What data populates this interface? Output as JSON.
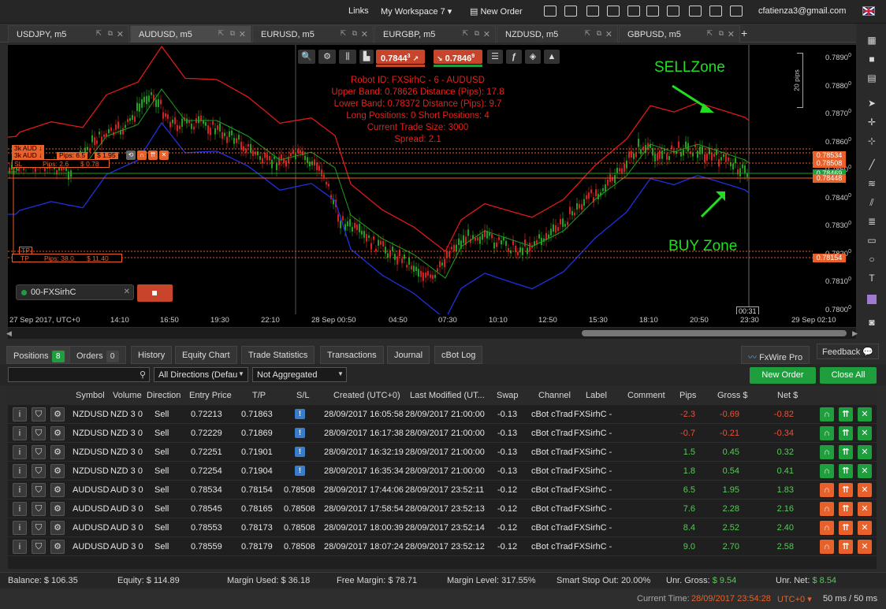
{
  "topbar": {
    "links_label": "Links",
    "workspace_label": "My Workspace 7",
    "new_order_label": "New Order",
    "user_email": "cfatienza3@gmail.com"
  },
  "tabs": [
    {
      "label": "USDJPY, m5"
    },
    {
      "label": "AUDUSD, m5"
    },
    {
      "label": "EURUSD, m5"
    },
    {
      "label": "EURGBP, m5"
    },
    {
      "label": "NZDUSD, m5"
    },
    {
      "label": "GBPUSD, m5"
    }
  ],
  "tab_add_label": "+",
  "chart": {
    "sell_price": "0.7844",
    "sell_price_sup": "3",
    "buy_price": "0.7846",
    "buy_price_sup": "9",
    "info_lines": [
      "Robot ID: FXSirhC - 6 - AUDUSD",
      "Upper Band: 0.78626 Distance (Pips): 17.8",
      "Lower Band: 0.78372 Distance (Pips): 9.7",
      "Long Positions: 0 Short Positions: 4",
      "Current Trade Size: 3000",
      "Spread: 2.1"
    ],
    "sell_zone_label": "SELLZone",
    "buy_zone_label": "BUY Zone",
    "pos_labels": {
      "a1": "3k AUD ↓",
      "a2": "3k AUD ↓",
      "pips1": "Pips: 6.5",
      "usd1": "$ 1.95",
      "sl": "SL",
      "sl_pips": "Pips: 2.6",
      "sl_usd": "$ 0.78",
      "tp1": "TP",
      "tp2": "TP",
      "tp_pips": "Pips: 38.0",
      "tp_usd": "$ 11.40"
    },
    "cbot_label": "00-FXSirhC",
    "pips_scale_label": "20 pips",
    "cursor_time": "00:31",
    "price_labels": [
      "0.7890",
      "0.7880",
      "0.7870",
      "0.7860",
      "0.7850",
      "0.7840",
      "0.7830",
      "0.7820",
      "0.7810",
      "0.7800"
    ],
    "price_label_sup": [
      "0",
      "0",
      "0",
      "0",
      "0",
      "0",
      "0",
      "0",
      "0",
      "0"
    ],
    "price_tags": [
      {
        "v": "0.78534",
        "color": "#e8602a"
      },
      {
        "v": "0.78508",
        "color": "#e8602a"
      },
      {
        "v": "0.78469",
        "color": "#1e9e3c"
      },
      {
        "v": "0.78448",
        "color": "#e8602a"
      },
      {
        "v": "0.78154",
        "color": "#e8602a"
      }
    ],
    "time_labels": [
      "27 Sep 2017, UTC+0",
      "14:10",
      "16:50",
      "19:30",
      "22:10",
      "28 Sep 00:50",
      "04:50",
      "07:30",
      "10:10",
      "12:50",
      "15:30",
      "18:10",
      "20:50",
      "23:30",
      "29 Sep 02:10"
    ]
  },
  "bottom_tabs": {
    "positions": "Positions",
    "positions_count": "8",
    "orders": "Orders",
    "orders_count": "0",
    "history": "History",
    "equity": "Equity Chart",
    "stats": "Trade Statistics",
    "transactions": "Transactions",
    "journal": "Journal",
    "cbotlog": "cBot Log",
    "fxwire": "FxWire Pro",
    "feedback": "Feedback"
  },
  "filters": {
    "directions": "All Directions (Defau",
    "aggregation": "Not Aggregated",
    "new_order": "New Order",
    "close_all": "Close All"
  },
  "columns": [
    "Symbol",
    "Volume",
    "Direction",
    "Entry Price",
    "T/P",
    "S/L",
    "Created (UTC+0)",
    "Last Modified (UT...",
    "Swap",
    "Channel",
    "Label",
    "Comment",
    "Pips",
    "Gross $",
    "Net $"
  ],
  "rows": [
    {
      "symbol": "NZDUSD",
      "volume": "NZD 3 0",
      "direction": "Sell",
      "entry": "0.72213",
      "tp": "0.71863",
      "sl": "",
      "created": "28/09/2017 16:05:58",
      "modified": "28/09/2017 21:00:00",
      "swap": "-0.13",
      "channel": "cBot cTrad",
      "label": "FXSirhC - 6",
      "comment": "",
      "pips": "-2.3",
      "gross": "-0.69",
      "net": "-0.82",
      "side": "nzd"
    },
    {
      "symbol": "NZDUSD",
      "volume": "NZD 3 0",
      "direction": "Sell",
      "entry": "0.72229",
      "tp": "0.71869",
      "sl": "",
      "created": "28/09/2017 16:17:38",
      "modified": "28/09/2017 21:00:00",
      "swap": "-0.13",
      "channel": "cBot cTrad",
      "label": "FXSirhC - 6",
      "comment": "",
      "pips": "-0.7",
      "gross": "-0.21",
      "net": "-0.34",
      "side": "nzd"
    },
    {
      "symbol": "NZDUSD",
      "volume": "NZD 3 0",
      "direction": "Sell",
      "entry": "0.72251",
      "tp": "0.71901",
      "sl": "",
      "created": "28/09/2017 16:32:19",
      "modified": "28/09/2017 21:00:00",
      "swap": "-0.13",
      "channel": "cBot cTrad",
      "label": "FXSirhC - 6",
      "comment": "",
      "pips": "1.5",
      "gross": "0.45",
      "net": "0.32",
      "side": "nzd"
    },
    {
      "symbol": "NZDUSD",
      "volume": "NZD 3 0",
      "direction": "Sell",
      "entry": "0.72254",
      "tp": "0.71904",
      "sl": "",
      "created": "28/09/2017 16:35:34",
      "modified": "28/09/2017 21:00:00",
      "swap": "-0.13",
      "channel": "cBot cTrad",
      "label": "FXSirhC - 6",
      "comment": "",
      "pips": "1.8",
      "gross": "0.54",
      "net": "0.41",
      "side": "nzd"
    },
    {
      "symbol": "AUDUSD",
      "volume": "AUD 3 0",
      "direction": "Sell",
      "entry": "0.78534",
      "tp": "0.78154",
      "sl": "0.78508",
      "created": "28/09/2017 17:44:06",
      "modified": "28/09/2017 23:52:11",
      "swap": "-0.12",
      "channel": "cBot cTrad",
      "label": "FXSirhC - 6",
      "comment": "",
      "pips": "6.5",
      "gross": "1.95",
      "net": "1.83",
      "side": "aud"
    },
    {
      "symbol": "AUDUSD",
      "volume": "AUD 3 0",
      "direction": "Sell",
      "entry": "0.78545",
      "tp": "0.78165",
      "sl": "0.78508",
      "created": "28/09/2017 17:58:54",
      "modified": "28/09/2017 23:52:13",
      "swap": "-0.12",
      "channel": "cBot cTrad",
      "label": "FXSirhC - 6",
      "comment": "",
      "pips": "7.6",
      "gross": "2.28",
      "net": "2.16",
      "side": "aud"
    },
    {
      "symbol": "AUDUSD",
      "volume": "AUD 3 0",
      "direction": "Sell",
      "entry": "0.78553",
      "tp": "0.78173",
      "sl": "0.78508",
      "created": "28/09/2017 18:00:39",
      "modified": "28/09/2017 23:52:14",
      "swap": "-0.12",
      "channel": "cBot cTrad",
      "label": "FXSirhC - 6",
      "comment": "",
      "pips": "8.4",
      "gross": "2.52",
      "net": "2.40",
      "side": "aud"
    },
    {
      "symbol": "AUDUSD",
      "volume": "AUD 3 0",
      "direction": "Sell",
      "entry": "0.78559",
      "tp": "0.78179",
      "sl": "0.78508",
      "created": "28/09/2017 18:07:24",
      "modified": "28/09/2017 23:52:12",
      "swap": "-0.12",
      "channel": "cBot cTrad",
      "label": "FXSirhC - 6",
      "comment": "",
      "pips": "9.0",
      "gross": "2.70",
      "net": "2.58",
      "side": "aud"
    }
  ],
  "status": {
    "balance_label": "Balance:",
    "balance": "$ 106.35",
    "equity_label": "Equity:",
    "equity": "$ 114.89",
    "margin_used_label": "Margin Used:",
    "margin_used": "$ 36.18",
    "free_margin_label": "Free Margin:",
    "free_margin": "$ 78.71",
    "margin_level_label": "Margin Level:",
    "margin_level": "317.55%",
    "smart_stop_label": "Smart Stop Out:",
    "smart_stop": "20.00%",
    "unr_gross_label": "Unr. Gross:",
    "unr_gross": "$ 9.54",
    "unr_net_label": "Unr. Net:",
    "unr_net": "$ 8.54"
  },
  "bottombar": {
    "current_time_label": "Current Time:",
    "current_time": "28/09/2017 23:54:28",
    "tz": "UTC+0",
    "latency": "50 ms / 50 ms"
  },
  "colors": {
    "accent_green": "#1e9e3c",
    "accent_orange": "#e8602a",
    "negative": "#e8523a",
    "positive": "#5ac85a"
  }
}
